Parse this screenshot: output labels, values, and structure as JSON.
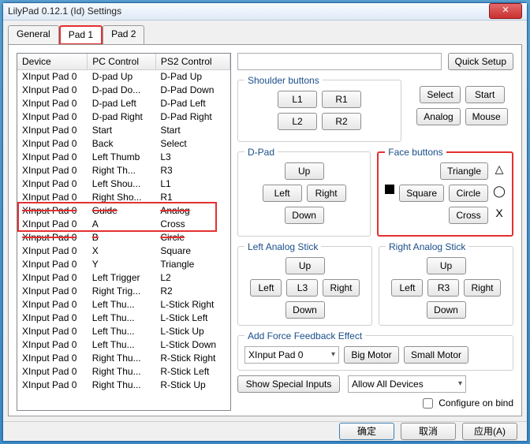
{
  "window": {
    "title": "LilyPad 0.12.1 (Id) Settings",
    "close": "✕"
  },
  "tabs": {
    "items": [
      "General",
      "Pad 1",
      "Pad 2"
    ],
    "active": 1
  },
  "list": {
    "cols": [
      "Device",
      "PC Control",
      "PS2 Control"
    ],
    "rows": [
      {
        "d": "XInput Pad 0",
        "pc": "D-pad Up",
        "ps": "D-Pad Up"
      },
      {
        "d": "XInput Pad 0",
        "pc": "D-pad Do...",
        "ps": "D-Pad Down"
      },
      {
        "d": "XInput Pad 0",
        "pc": "D-pad Left",
        "ps": "D-Pad Left"
      },
      {
        "d": "XInput Pad 0",
        "pc": "D-pad Right",
        "ps": "D-Pad Right"
      },
      {
        "d": "XInput Pad 0",
        "pc": "Start",
        "ps": "Start"
      },
      {
        "d": "XInput Pad 0",
        "pc": "Back",
        "ps": "Select"
      },
      {
        "d": "XInput Pad 0",
        "pc": "Left Thumb",
        "ps": "L3"
      },
      {
        "d": "XInput Pad 0",
        "pc": "Right Th...",
        "ps": "R3"
      },
      {
        "d": "XInput Pad 0",
        "pc": "Left Shou...",
        "ps": "L1"
      },
      {
        "d": "XInput Pad 0",
        "pc": "Right Sho...",
        "ps": "R1"
      },
      {
        "d": "XInput Pad 0",
        "pc": "Guide",
        "ps": "Analog",
        "strike": true
      },
      {
        "d": "XInput Pad 0",
        "pc": "A",
        "ps": "Cross"
      },
      {
        "d": "XInput Pad 0",
        "pc": "B",
        "ps": "Circle",
        "strike": true
      },
      {
        "d": "XInput Pad 0",
        "pc": "X",
        "ps": "Square"
      },
      {
        "d": "XInput Pad 0",
        "pc": "Y",
        "ps": "Triangle"
      },
      {
        "d": "XInput Pad 0",
        "pc": "Left Trigger",
        "ps": "L2"
      },
      {
        "d": "XInput Pad 0",
        "pc": "Right Trig...",
        "ps": "R2"
      },
      {
        "d": "XInput Pad 0",
        "pc": "Left Thu...",
        "ps": "L-Stick Right"
      },
      {
        "d": "XInput Pad 0",
        "pc": "Left Thu...",
        "ps": "L-Stick Left"
      },
      {
        "d": "XInput Pad 0",
        "pc": "Left Thu...",
        "ps": "L-Stick Up"
      },
      {
        "d": "XInput Pad 0",
        "pc": "Left Thu...",
        "ps": "L-Stick Down"
      },
      {
        "d": "XInput Pad 0",
        "pc": "Right Thu...",
        "ps": "R-Stick Right"
      },
      {
        "d": "XInput Pad 0",
        "pc": "Right Thu...",
        "ps": "R-Stick Left"
      },
      {
        "d": "XInput Pad 0",
        "pc": "Right Thu...",
        "ps": "R-Stick Up"
      }
    ]
  },
  "quick_setup": "Quick Setup",
  "shoulder": {
    "legend": "Shoulder buttons",
    "l1": "L1",
    "r1": "R1",
    "l2": "L2",
    "r2": "R2"
  },
  "side_btns": {
    "select": "Select",
    "start": "Start",
    "analog": "Analog",
    "mouse": "Mouse"
  },
  "dpad": {
    "legend": "D-Pad",
    "up": "Up",
    "down": "Down",
    "left": "Left",
    "right": "Right"
  },
  "face": {
    "legend": "Face buttons",
    "triangle": "Triangle",
    "square": "Square",
    "circle": "Circle",
    "cross": "Cross"
  },
  "lstick": {
    "legend": "Left Analog Stick",
    "up": "Up",
    "down": "Down",
    "left": "Left",
    "right": "Right",
    "l3": "L3"
  },
  "rstick": {
    "legend": "Right Analog Stick",
    "up": "Up",
    "down": "Down",
    "left": "Left",
    "right": "Right",
    "r3": "R3"
  },
  "ffb": {
    "legend": "Add Force Feedback Effect",
    "device": "XInput Pad 0",
    "big": "Big Motor",
    "small": "Small Motor"
  },
  "special": "Show Special Inputs",
  "allow": "Allow All Devices",
  "cfg_bind": "Configure on bind",
  "footer": {
    "ok": "确定",
    "cancel": "取消",
    "apply": "应用(A)"
  }
}
